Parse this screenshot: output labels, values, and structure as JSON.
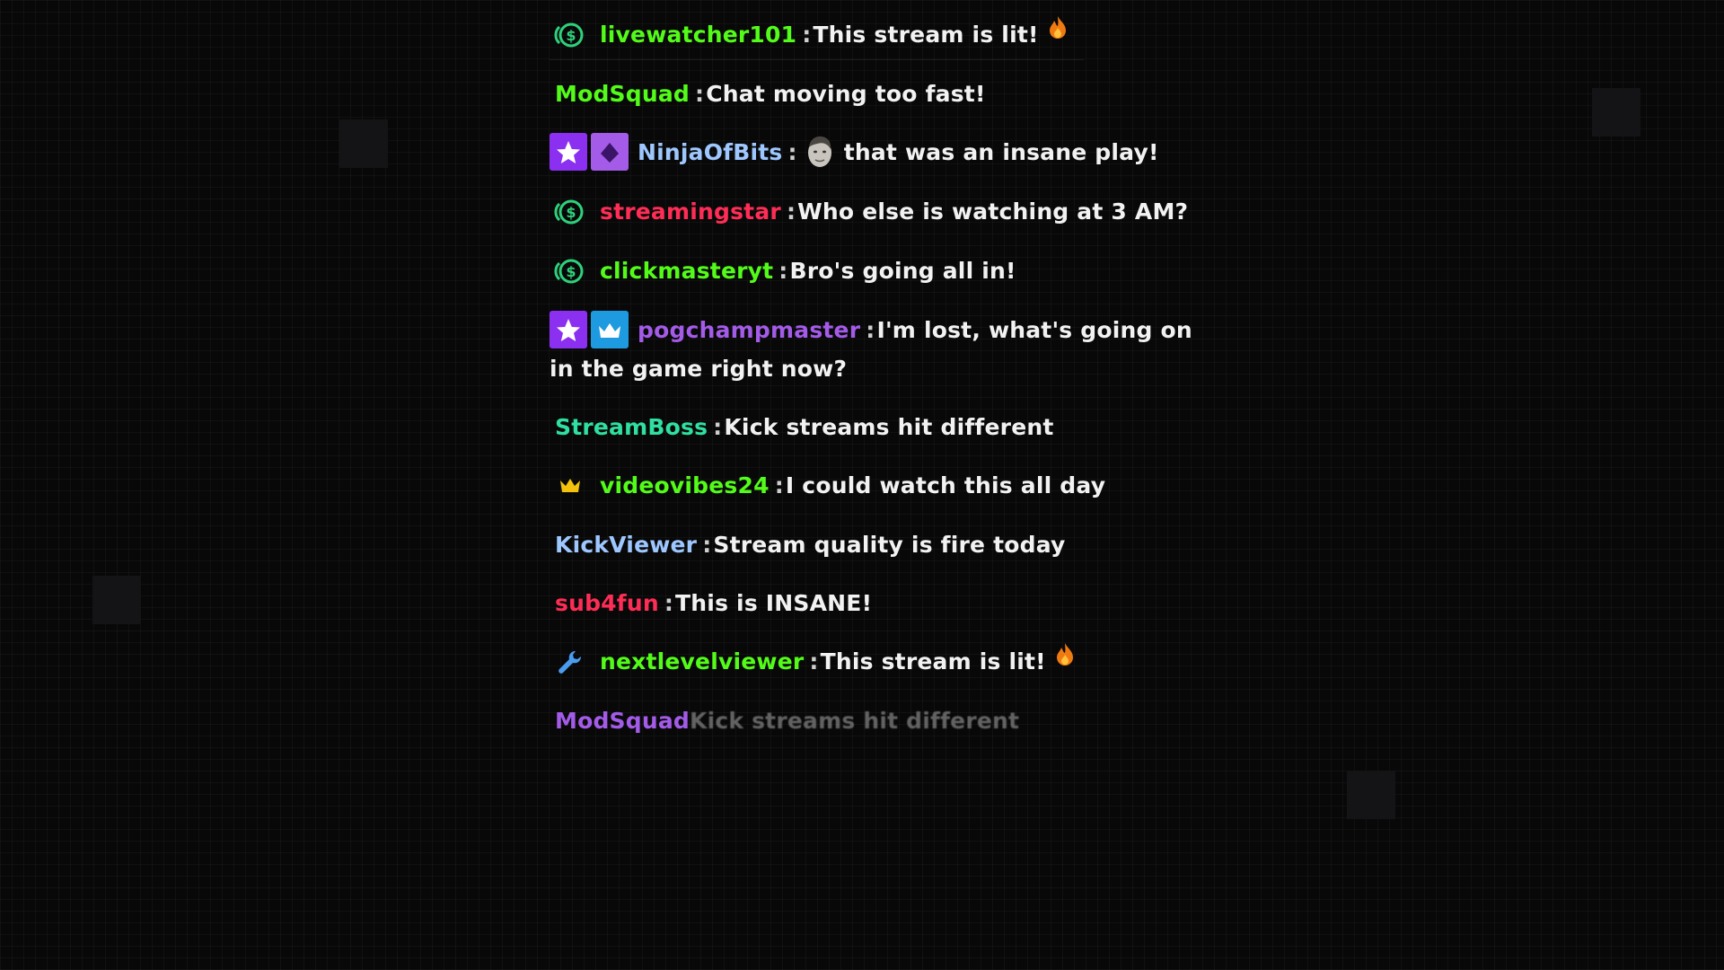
{
  "colors": {
    "background": "#080809",
    "text": "#f2f2f2",
    "badge_purple": "#8b2ff0",
    "badge_violet": "#a35be8",
    "badge_blue": "#1e9be0",
    "dollar_green": "#2fd07a",
    "crown_gold": "#f4c20d"
  },
  "chat": {
    "messages": [
      {
        "badges": [
          "dollar-coin-icon"
        ],
        "user": "livewatcher101",
        "user_color": "#53fc18",
        "separator": ":",
        "text": "This stream is lit!",
        "trailing_emoji": "fire-icon"
      },
      {
        "badges": [],
        "user": "ModSquad",
        "user_color": "#53fc18",
        "separator": ":",
        "text": "Chat moving too fast!"
      },
      {
        "badges": [
          "star-icon",
          "diamond-icon"
        ],
        "user": "NinjaOfBits",
        "user_color": "#9ec7ff",
        "separator": ":",
        "inline_emote": "face-emote-icon",
        "text": "that was an insane play!"
      },
      {
        "badges": [
          "dollar-coin-icon"
        ],
        "user": "streamingstar",
        "user_color": "#ff2d55",
        "separator": ":",
        "text": "Who else is watching at 3 AM?"
      },
      {
        "badges": [
          "dollar-coin-icon"
        ],
        "user": "clickmasteryt",
        "user_color": "#53fc18",
        "separator": ":",
        "text": "Bro's going all in!"
      },
      {
        "badges": [
          "star-icon",
          "crown-icon"
        ],
        "user": "pogchampmaster",
        "user_color": "#a35be8",
        "separator": ":",
        "text": "I'm lost, what's going on in the game right now?"
      },
      {
        "badges": [],
        "user": "StreamBoss",
        "user_color": "#2fe0a0",
        "separator": ":",
        "text": "Kick streams hit different"
      },
      {
        "badges": [
          "crown-icon"
        ],
        "user": "videovibes24",
        "user_color": "#53fc18",
        "separator": ":",
        "text": "I could watch this all day"
      },
      {
        "badges": [],
        "user": "KickViewer",
        "user_color": "#9ec7ff",
        "separator": ":",
        "text": "Stream quality is fire today"
      },
      {
        "badges": [],
        "user": "sub4fun",
        "user_color": "#ff2d55",
        "separator": ":",
        "text": "This is INSANE!"
      },
      {
        "badges": [
          "wrench-icon"
        ],
        "user": "nextlevelviewer",
        "user_color": "#53fc18",
        "separator": ":",
        "text": "This stream is lit!",
        "trailing_emoji": "fire-icon"
      },
      {
        "badges": [],
        "user": "ModSquad",
        "user_color": "#a35be8",
        "separator": "",
        "text": "Kick streams hit different"
      }
    ]
  }
}
